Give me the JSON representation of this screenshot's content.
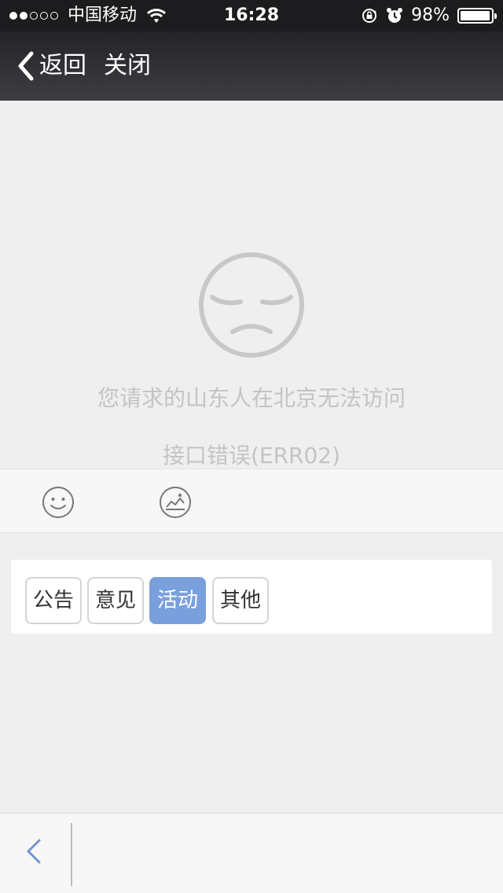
{
  "status_bar": {
    "carrier": "中国移动",
    "time": "16:28",
    "battery": "98%",
    "battery_level": 0.98,
    "signal_strength": 2,
    "icons": [
      "signal-dots-icon",
      "wifi-icon",
      "rotation-lock-icon",
      "alarm-icon",
      "battery-icon"
    ]
  },
  "nav": {
    "back_label": "返回",
    "close_label": "关闭"
  },
  "error": {
    "icon": "sad-face-icon",
    "message": "您请求的山东人在北京无法访问",
    "code": "接口错误(ERR02)"
  },
  "toolbar": {
    "icons": [
      "emoji-icon",
      "image-icon"
    ]
  },
  "categories": [
    {
      "label": "公告",
      "selected": false
    },
    {
      "label": "意见",
      "selected": false
    },
    {
      "label": "活动",
      "selected": true
    },
    {
      "label": "其他",
      "selected": false
    }
  ],
  "bottom_bar": {
    "icons": [
      "chevron-left-icon"
    ]
  },
  "colors": {
    "accent": "#7a9fdd",
    "status_bar": "#1c1c1e",
    "nav_bar": "#2e2e32",
    "background": "#efefef",
    "muted_text": "#c4c4c4"
  }
}
